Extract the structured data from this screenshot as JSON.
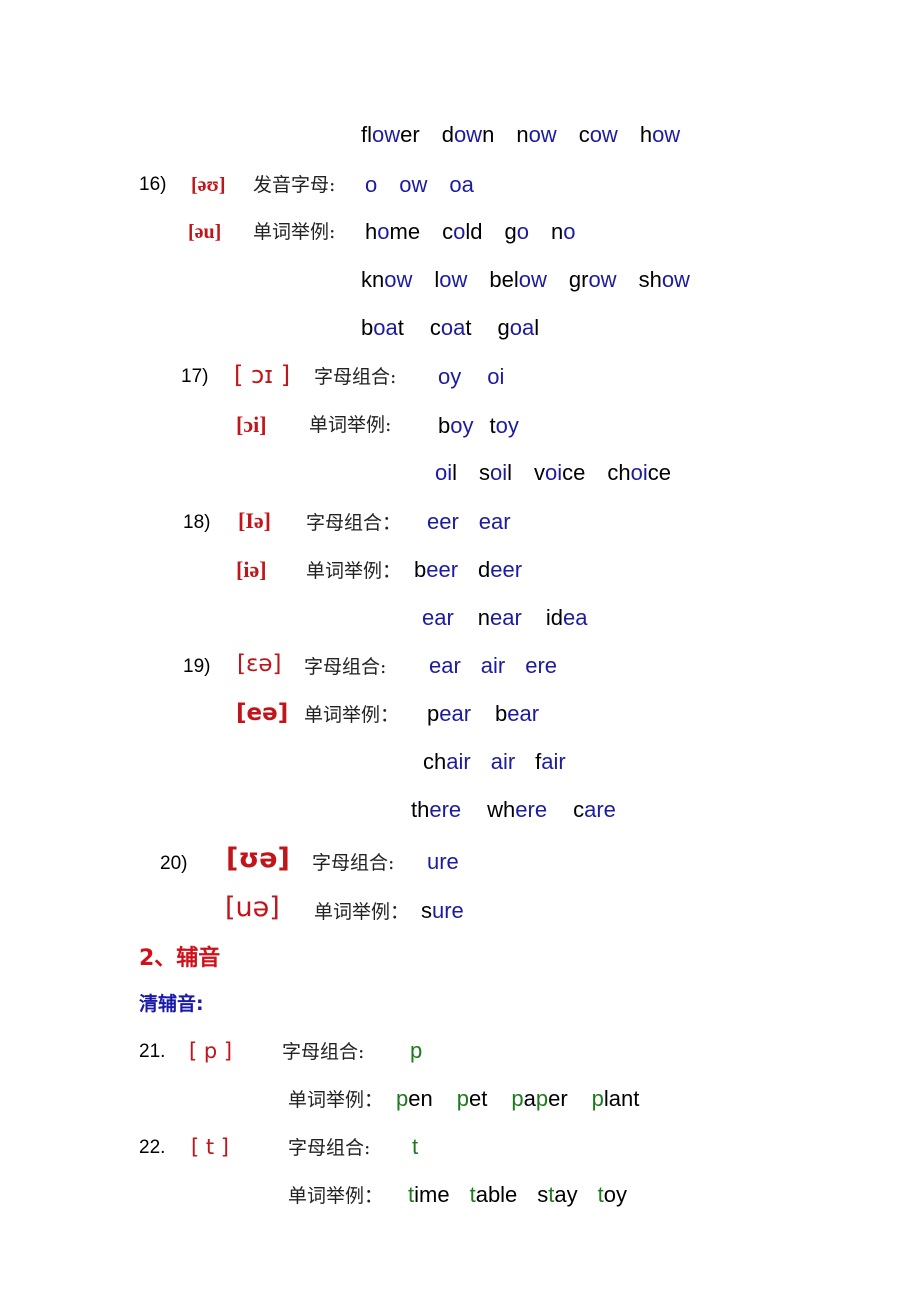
{
  "accent_colors": {
    "ipa_red": "#c0161b",
    "highlight_blue": "#1c1ca0",
    "highlight_green": "#1d7a1d",
    "heading_red": "#d0101a",
    "subheading_blue": "#1a1aa8"
  },
  "top_line": [
    {
      "pre": "fl",
      "hl": "ow",
      "post": "er"
    },
    {
      "pre": "d",
      "hl": "ow",
      "post": "n"
    },
    {
      "pre": "n",
      "hl": "ow",
      "post": ""
    },
    {
      "pre": "c",
      "hl": "ow",
      "post": ""
    },
    {
      "pre": "h",
      "hl": "ow",
      "post": ""
    }
  ],
  "item16": {
    "num": "16)",
    "ipa1": "[əʊ]",
    "label1": "发音字母:",
    "letters": [
      "o",
      "ow",
      "oa"
    ],
    "ipa2": "[əu]",
    "label2": "单词举例:",
    "row1": [
      {
        "pre": "h",
        "hl": "o",
        "post": "me"
      },
      {
        "pre": "c",
        "hl": "o",
        "post": "ld"
      },
      {
        "pre": "g",
        "hl": "o",
        "post": ""
      },
      {
        "pre": "n",
        "hl": "o",
        "post": ""
      }
    ],
    "row2": [
      {
        "pre": "kn",
        "hl": "ow",
        "post": ""
      },
      {
        "pre": "l",
        "hl": "ow",
        "post": ""
      },
      {
        "pre": "bel",
        "hl": "ow",
        "post": ""
      },
      {
        "pre": "gr",
        "hl": "ow",
        "post": ""
      },
      {
        "pre": "sh",
        "hl": "ow",
        "post": ""
      }
    ],
    "row3": [
      {
        "pre": "b",
        "hl": "oa",
        "post": "t"
      },
      {
        "pre": "c",
        "hl": "oa",
        "post": "t"
      },
      {
        "pre": "g",
        "hl": "oa",
        "post": "l"
      }
    ]
  },
  "item17": {
    "num": "17)",
    "ipa1": "[ ɔɪ ]",
    "label1": "字母组合:",
    "letters": [
      "oy",
      "oi"
    ],
    "ipa2": "[ɔi]",
    "label2": "单词举例:",
    "row1": [
      {
        "pre": "b",
        "hl": "oy",
        "post": ""
      },
      {
        "pre": "t",
        "hl": "oy",
        "post": ""
      }
    ],
    "row2": [
      {
        "pre": "",
        "hl": "oi",
        "post": "l"
      },
      {
        "pre": "s",
        "hl": "oi",
        "post": "l"
      },
      {
        "pre": "v",
        "hl": "oi",
        "post": "ce"
      },
      {
        "pre": "ch",
        "hl": "oi",
        "post": "ce"
      }
    ]
  },
  "item18": {
    "num": "18)",
    "ipa1": "[Iə]",
    "label1": "字母组合：",
    "letters": [
      "eer",
      "ear"
    ],
    "ipa2": "[iə]",
    "label2": "单词举例：",
    "row1": [
      {
        "pre": "b",
        "hl": "eer",
        "post": ""
      },
      {
        "pre": "d",
        "hl": "eer",
        "post": ""
      }
    ],
    "row2": [
      {
        "pre": "",
        "hl": "ear",
        "post": ""
      },
      {
        "pre": "n",
        "hl": "ear",
        "post": ""
      },
      {
        "pre": "id",
        "hl": "ea",
        "post": ""
      }
    ]
  },
  "item19": {
    "num": "19)",
    "ipa1": "[ɛə]",
    "label1": "字母组合:",
    "letters": [
      "ear",
      "air",
      "ere"
    ],
    "ipa2": "[eə]",
    "label2": "单词举例：",
    "row1": [
      {
        "pre": "p",
        "hl": "ear",
        "post": ""
      },
      {
        "pre": "b",
        "hl": "ear",
        "post": ""
      }
    ],
    "row2": [
      {
        "pre": "ch",
        "hl": "air",
        "post": ""
      },
      {
        "pre": "",
        "hl": "air",
        "post": ""
      },
      {
        "pre": "f",
        "hl": "air",
        "post": ""
      }
    ],
    "row3": [
      {
        "pre": "th",
        "hl": "ere",
        "post": ""
      },
      {
        "pre": "wh",
        "hl": "ere",
        "post": ""
      },
      {
        "pre": "c",
        "hl": "are",
        "post": ""
      }
    ]
  },
  "item20": {
    "num": "20)",
    "ipa1": "[ʊə]",
    "label1": "字母组合:",
    "letters": [
      "ure"
    ],
    "ipa2": "[uə]",
    "label2": "单词举例：",
    "row1": [
      {
        "pre": "s",
        "hl": "ure",
        "post": ""
      }
    ]
  },
  "section2_heading": "2、辅音",
  "voiceless_heading": "清辅音:",
  "item21": {
    "num": "21.",
    "ipa": "[ p ]",
    "label1": "字母组合:",
    "letters": [
      "p"
    ],
    "label2": "单词举例：",
    "row1": [
      {
        "pre": "",
        "hl": "p",
        "post": "en"
      },
      {
        "pre": "",
        "hl": "p",
        "post": "et"
      },
      {
        "pre": "",
        "hl": "p",
        "post": "a",
        "hl2": "p",
        "post2": "er"
      },
      {
        "pre": "",
        "hl": "p",
        "post": "lant"
      }
    ]
  },
  "item22": {
    "num": "22.",
    "ipa": "[ t ]",
    "label1": "字母组合:",
    "letters": [
      "t"
    ],
    "label2": "单词举例：",
    "row1": [
      {
        "pre": "",
        "hl": "t",
        "post": "ime"
      },
      {
        "pre": "",
        "hl": "t",
        "post": "able"
      },
      {
        "pre": "s",
        "hl": "t",
        "post": "ay"
      },
      {
        "pre": "",
        "hl": "t",
        "post": "oy"
      }
    ]
  }
}
